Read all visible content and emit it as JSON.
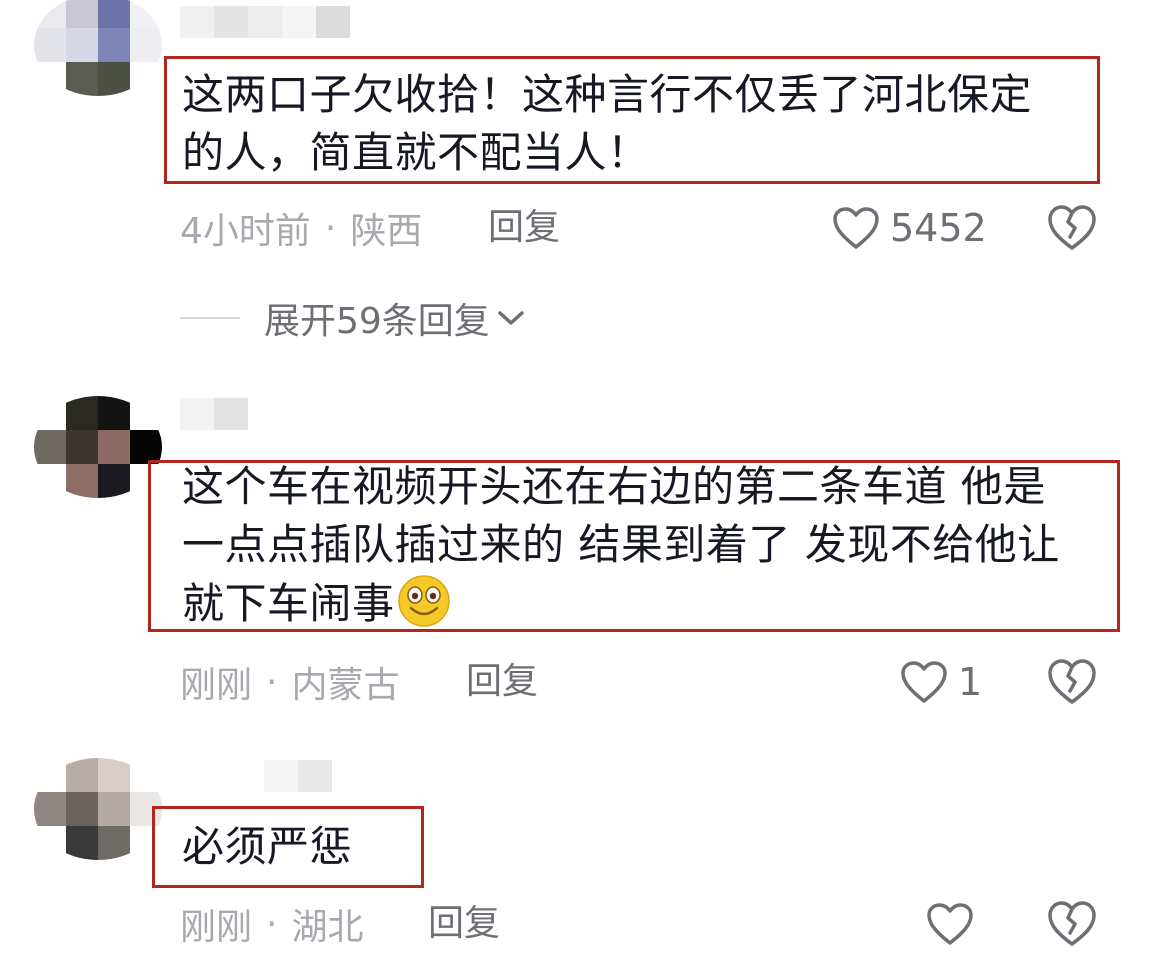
{
  "comments": [
    {
      "text_lines": [
        "这两口子欠收拾！这种言行不仅丢了河北保定",
        "的人，简直就不配当人！"
      ],
      "time": "4小时前",
      "location": "陕西",
      "reply_label": "回复",
      "like_count": "5452",
      "replies_label": "展开59条回复"
    },
    {
      "text_lines": [
        "这个车在视频开头还在右边的第二条车道  他是",
        "一点点插队插过来的 结果到着了 发现不给他让",
        "就下车闹事"
      ],
      "emoji": "grinning-emoji",
      "time": "刚刚",
      "location": "内蒙古",
      "reply_label": "回复",
      "like_count": "1"
    },
    {
      "text_lines": [
        "必须严惩"
      ],
      "time": "刚刚",
      "location": "湖北",
      "reply_label": "回复",
      "like_count": ""
    }
  ],
  "separator": "·",
  "icons": {
    "like": "heart-outline-icon",
    "dislike": "broken-heart-icon",
    "expand": "chevron-down-icon"
  },
  "colors": {
    "highlight_box": "#b3261e",
    "meta_text": "#a8a9ae",
    "action_text": "#6e6f75"
  }
}
